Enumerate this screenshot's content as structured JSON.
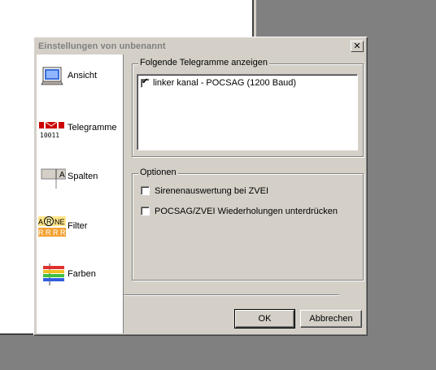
{
  "dialog": {
    "title": "Einstellungen von unbenannt",
    "close_symbol": "✕"
  },
  "nav": {
    "items": [
      {
        "label": "Ansicht",
        "icon": "monitor-icon"
      },
      {
        "label": "Telegramme",
        "icon": "telegram-icon"
      },
      {
        "label": "Spalten",
        "icon": "columns-icon"
      },
      {
        "label": "Filter",
        "icon": "filter-icon"
      },
      {
        "label": "Farben",
        "icon": "colors-icon"
      }
    ],
    "telegram_icon_text": "10011",
    "column_icon_text": "A",
    "filter_icon_top": "A",
    "filter_icon_r": "R",
    "filter_icon_ne": "NE",
    "filter_icon_bottom": "R R R R"
  },
  "telegrams_group": {
    "legend": "Folgende Telegramme anzeigen",
    "items": [
      {
        "label": "linker kanal - POCSAG (1200 Baud)",
        "checked": true
      }
    ]
  },
  "options_group": {
    "legend": "Optionen",
    "sirene_label": "Sirenenauswertung bei ZVEI",
    "sirene_checked": false,
    "repeat_label": "POCSAG/ZVEI Wiederholungen unterdrücken",
    "repeat_checked": false
  },
  "buttons": {
    "ok_label": "OK",
    "cancel_label": "Abbrechen"
  },
  "check_mark": "✔"
}
